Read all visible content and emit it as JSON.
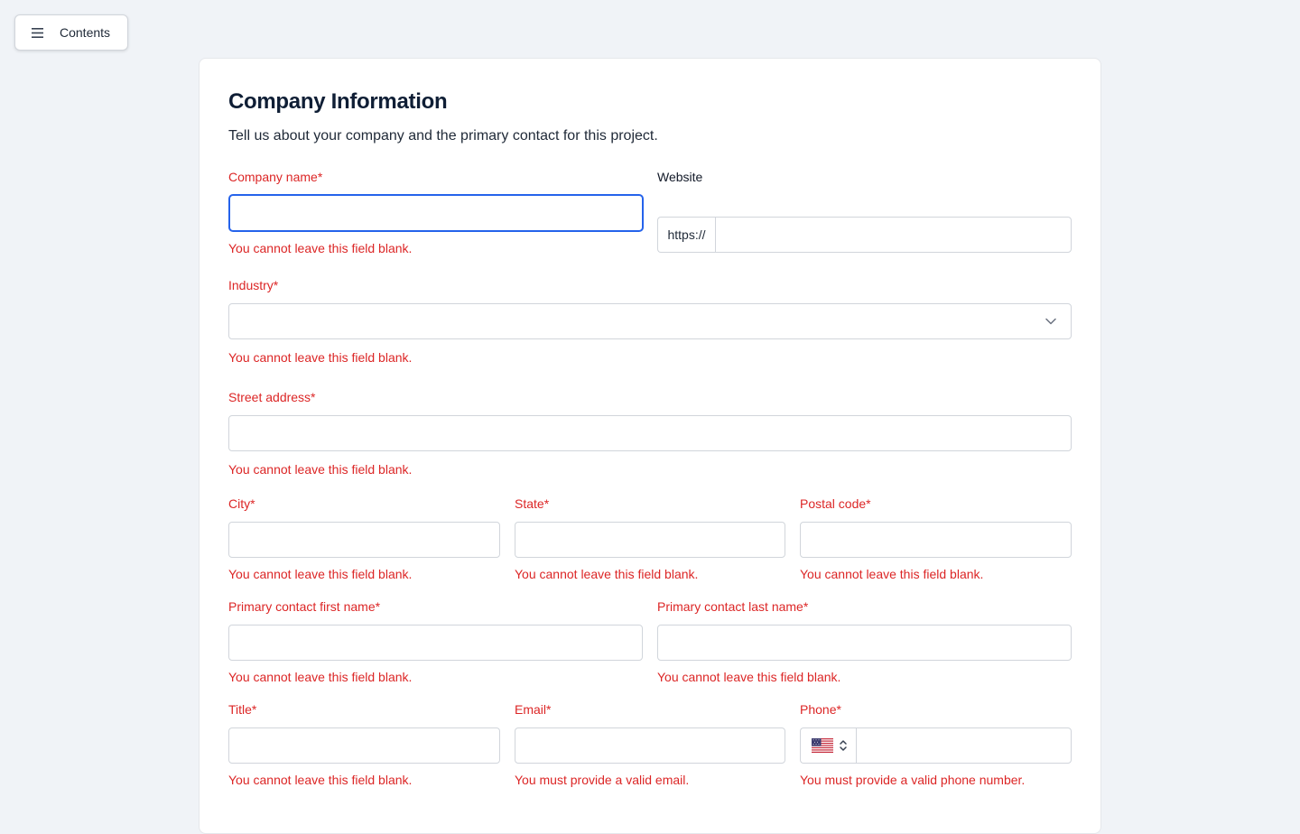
{
  "toc": {
    "label": "Contents",
    "icon": "menu-icon"
  },
  "header": {
    "title": "Company Information",
    "subtitle": "Tell us about your company and the primary contact for this project."
  },
  "fields": {
    "company_name": {
      "label": "Company name*",
      "error": "You cannot leave this field blank.",
      "value": ""
    },
    "website": {
      "label": "Website",
      "prefix": "https://",
      "value": ""
    },
    "industry": {
      "label": "Industry*",
      "error": "You cannot leave this field blank.",
      "value": ""
    },
    "street": {
      "label": "Street address*",
      "error": "You cannot leave this field blank.",
      "value": ""
    },
    "city": {
      "label": "City*",
      "error": "You cannot leave this field blank.",
      "value": ""
    },
    "state": {
      "label": "State*",
      "error": "You cannot leave this field blank.",
      "value": ""
    },
    "postal": {
      "label": "Postal code*",
      "error": "You cannot leave this field blank.",
      "value": ""
    },
    "first_name": {
      "label": "Primary contact first name*",
      "error": "You cannot leave this field blank.",
      "value": ""
    },
    "last_name": {
      "label": "Primary contact last name*",
      "error": "You cannot leave this field blank.",
      "value": ""
    },
    "job_title": {
      "label": "Title*",
      "error": "You cannot leave this field blank.",
      "value": ""
    },
    "email": {
      "label": "Email*",
      "error": "You must provide a valid email.",
      "value": ""
    },
    "phone": {
      "label": "Phone*",
      "error": "You must provide a valid phone number.",
      "country_icon": "us-flag-icon",
      "value": ""
    }
  },
  "colors": {
    "error": "#dc2626",
    "focus": "#2563eb",
    "background": "#f0f3f7",
    "title": "#0f1e35"
  }
}
